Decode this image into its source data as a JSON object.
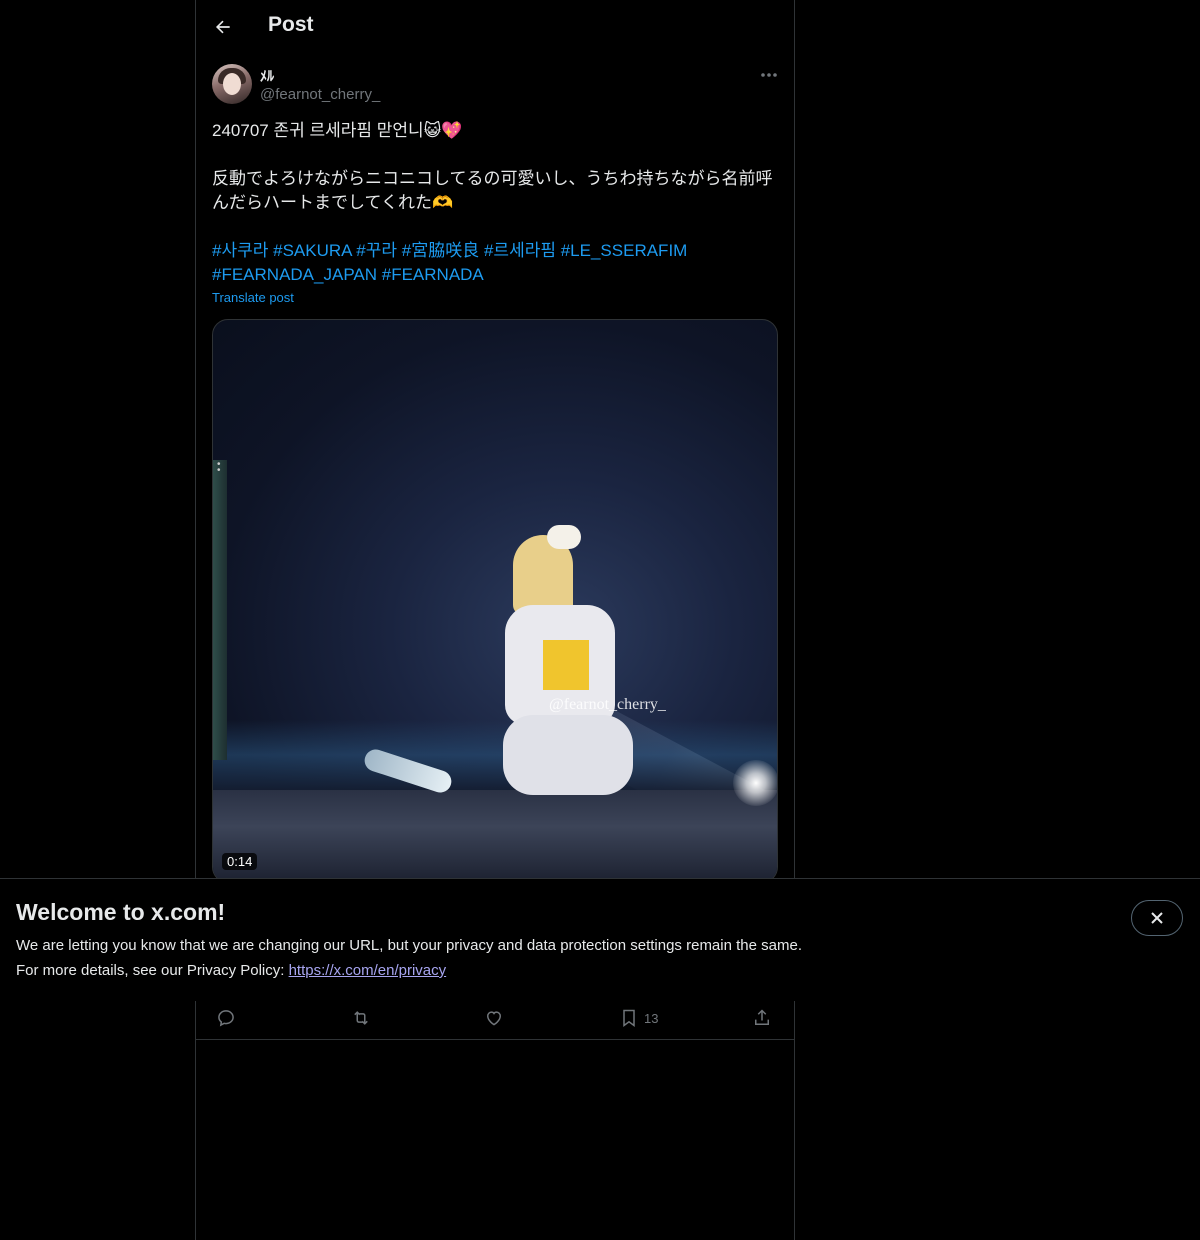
{
  "header": {
    "title": "Post"
  },
  "author": {
    "display_name": "ﾒﾙ",
    "handle": "@fearnot_cherry_"
  },
  "post": {
    "line1": "240707  존귀 르세라핌 맏언니😺💖",
    "line2": "反動でよろけながらニコニコしてるの可愛いし、うちわ持ちながら名前呼んだらハートまでしてくれた🫶",
    "hashtags": [
      "#사쿠라",
      "#SAKURA",
      "#꾸라",
      "#宮脇咲良",
      "#르세라핌",
      "#LE_SSERAFIM",
      "#FEARNADA_JAPAN",
      "#FEARNADA"
    ],
    "translate_label": "Translate post"
  },
  "media": {
    "duration": "0:14",
    "watermark": "@fearnot_cherry_"
  },
  "actions": {
    "bookmark_count": "13"
  },
  "banner": {
    "title": "Welcome to x.com!",
    "line1": "We are letting you know that we are changing our URL, but your privacy and data protection settings remain the same.",
    "line2_prefix": "For more details, see our Privacy Policy: ",
    "link": "https://x.com/en/privacy"
  },
  "colors": {
    "accent": "#1d9bf0",
    "text": "#e7e9ea",
    "muted": "#71767b",
    "border": "#2f3336"
  }
}
